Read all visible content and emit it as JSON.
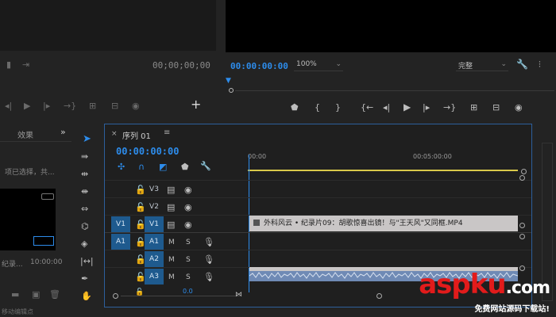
{
  "source_monitor": {
    "timecode": "00;00;00;00"
  },
  "program_monitor": {
    "timecode": "00:00:00:00",
    "zoom": "100%",
    "quality": "完整"
  },
  "effects_panel": {
    "tab_label": "效果",
    "selection_text": "项已选择，共...",
    "clip_name": "纪录...",
    "clip_duration": "10:00:00"
  },
  "timeline": {
    "sequence_name": "序列 01",
    "timecode": "00:00:00:00",
    "ruler": [
      "00:00",
      "00:05:00:00"
    ],
    "tracks": [
      {
        "name": "V3",
        "source": ""
      },
      {
        "name": "V2",
        "source": ""
      },
      {
        "name": "V1",
        "source": "V1"
      },
      {
        "name": "A1",
        "source": "A1",
        "m": "M",
        "s": "S"
      },
      {
        "name": "A2",
        "source": "",
        "m": "M",
        "s": "S"
      },
      {
        "name": "A3",
        "source": "",
        "m": "M",
        "s": "S"
      }
    ],
    "video_clip_label": "外科风云 • 纪录片09：胡歌惊喜出镜！与\"王天风\"又同框.MP4",
    "audio_value": "0.0"
  },
  "status_bar": {
    "text": "移动编辑点"
  },
  "watermark": {
    "main": "aspku",
    "tld": ".com",
    "sub": "免费网站源码下载站!"
  },
  "colors": {
    "accent_blue": "#2d8ceb",
    "selected_track": "#1e5a8e",
    "playhead_yellow": "#d9c94a",
    "watermark_red": "#e21b1b"
  }
}
